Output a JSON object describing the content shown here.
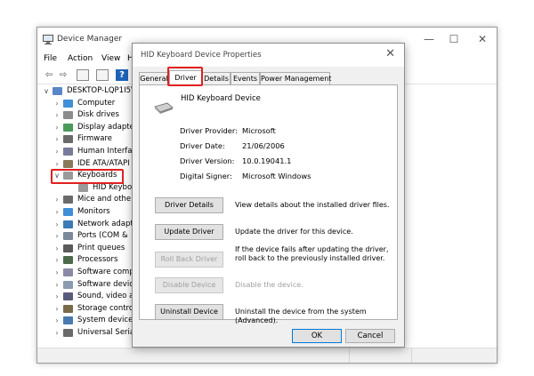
{
  "device_manager": {
    "title": "Device Manager",
    "menu": [
      "File",
      "Action",
      "View",
      "H"
    ],
    "tree": [
      {
        "label": "DESKTOP-LQP1I5V",
        "level": 0,
        "chevron": "v",
        "icon": "computer-icon"
      },
      {
        "label": "Computer",
        "level": 1,
        "chevron": ">",
        "icon": "monitor-icon"
      },
      {
        "label": "Disk drives",
        "level": 1,
        "chevron": ">",
        "icon": "disk-drive-icon"
      },
      {
        "label": "Display adapte",
        "level": 1,
        "chevron": ">",
        "icon": "display-adapter-icon"
      },
      {
        "label": "Firmware",
        "level": 1,
        "chevron": ">",
        "icon": "firmware-icon"
      },
      {
        "label": "Human Interfa",
        "level": 1,
        "chevron": ">",
        "icon": "hid-icon"
      },
      {
        "label": "IDE ATA/ATAPI",
        "level": 1,
        "chevron": ">",
        "icon": "ide-controller-icon"
      },
      {
        "label": "Keyboards",
        "level": 1,
        "chevron": "v",
        "icon": "keyboard-icon"
      },
      {
        "label": "HID Keybo",
        "level": 2,
        "chevron": "",
        "icon": "keyboard-icon"
      },
      {
        "label": "Mice and othe",
        "level": 1,
        "chevron": ">",
        "icon": "mouse-icon"
      },
      {
        "label": "Monitors",
        "level": 1,
        "chevron": ">",
        "icon": "monitor-icon"
      },
      {
        "label": "Network adapt",
        "level": 1,
        "chevron": ">",
        "icon": "network-adapter-icon"
      },
      {
        "label": "Ports (COM &",
        "level": 1,
        "chevron": ">",
        "icon": "port-icon"
      },
      {
        "label": "Print queues",
        "level": 1,
        "chevron": ">",
        "icon": "printer-icon"
      },
      {
        "label": "Processors",
        "level": 1,
        "chevron": ">",
        "icon": "processor-icon"
      },
      {
        "label": "Software comp",
        "level": 1,
        "chevron": ">",
        "icon": "software-component-icon"
      },
      {
        "label": "Software devic",
        "level": 1,
        "chevron": ">",
        "icon": "software-device-icon"
      },
      {
        "label": "Sound, video a",
        "level": 1,
        "chevron": ">",
        "icon": "speaker-icon"
      },
      {
        "label": "Storage contro",
        "level": 1,
        "chevron": ">",
        "icon": "storage-controller-icon"
      },
      {
        "label": "System devices",
        "level": 1,
        "chevron": ">",
        "icon": "system-device-icon"
      },
      {
        "label": "Universal Serial",
        "level": 1,
        "chevron": ">",
        "icon": "usb-icon"
      }
    ]
  },
  "dialog": {
    "title": "HID Keyboard Device Properties",
    "tabs": [
      "General",
      "Driver",
      "Details",
      "Events",
      "Power Management"
    ],
    "active_tab": "Driver",
    "device_name": "HID Keyboard Device",
    "properties": [
      {
        "label": "Driver Provider:",
        "value": "Microsoft"
      },
      {
        "label": "Driver Date:",
        "value": "21/06/2006"
      },
      {
        "label": "Driver Version:",
        "value": "10.0.19041.1"
      },
      {
        "label": "Digital Signer:",
        "value": "Microsoft Windows"
      }
    ],
    "actions": [
      {
        "label": "Driver Details",
        "desc": "View details about the installed driver files.",
        "enabled": true
      },
      {
        "label": "Update Driver",
        "desc": "Update the driver for this device.",
        "enabled": true
      },
      {
        "label": "Roll Back Driver",
        "desc": "If the device fails after updating the driver, roll back to the previously installed driver.",
        "enabled": false
      },
      {
        "label": "Disable Device",
        "desc": "Disable the device.",
        "enabled": false
      },
      {
        "label": "Uninstall Device",
        "desc": "Uninstall the device from the system (Advanced).",
        "enabled": true
      }
    ],
    "ok_label": "OK",
    "cancel_label": "Cancel"
  },
  "colors": {
    "highlight": "#e02020",
    "button_face": "#e1e1e1",
    "disabled_text": "#a0a0a0"
  }
}
